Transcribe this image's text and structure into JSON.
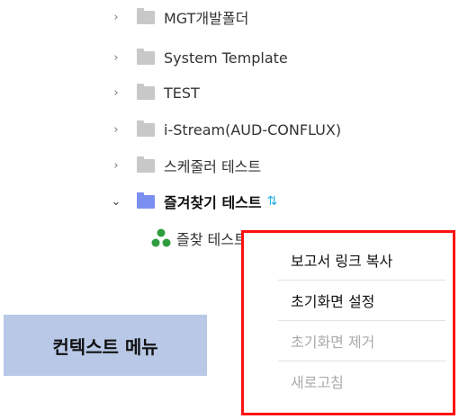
{
  "tree": {
    "items": [
      {
        "label": "MGT개발폴더"
      },
      {
        "label": "System Template"
      },
      {
        "label": "TEST"
      },
      {
        "label": "i-Stream(AUD-CONFLUX)"
      },
      {
        "label": "스케줄러 테스트"
      },
      {
        "label": "즐겨찾기 테스트"
      }
    ],
    "child": {
      "label": "즐찾 테스트"
    },
    "colors": {
      "folder": "#c8c8c8",
      "folder_open": "#7b8ff0",
      "sort_icon": "#22aee0",
      "rss": "#2e9d3f"
    }
  },
  "context_menu": {
    "items": [
      {
        "label": "보고서 링크 복사",
        "enabled": true
      },
      {
        "label": "초기화면 설정",
        "enabled": true
      },
      {
        "label": "초기화면 제거",
        "enabled": false
      },
      {
        "label": "새로고침",
        "enabled": false
      }
    ],
    "border_color": "#ff1010"
  },
  "annotation": {
    "label": "컨텍스트 메뉴",
    "background": "#b8c8e6"
  }
}
